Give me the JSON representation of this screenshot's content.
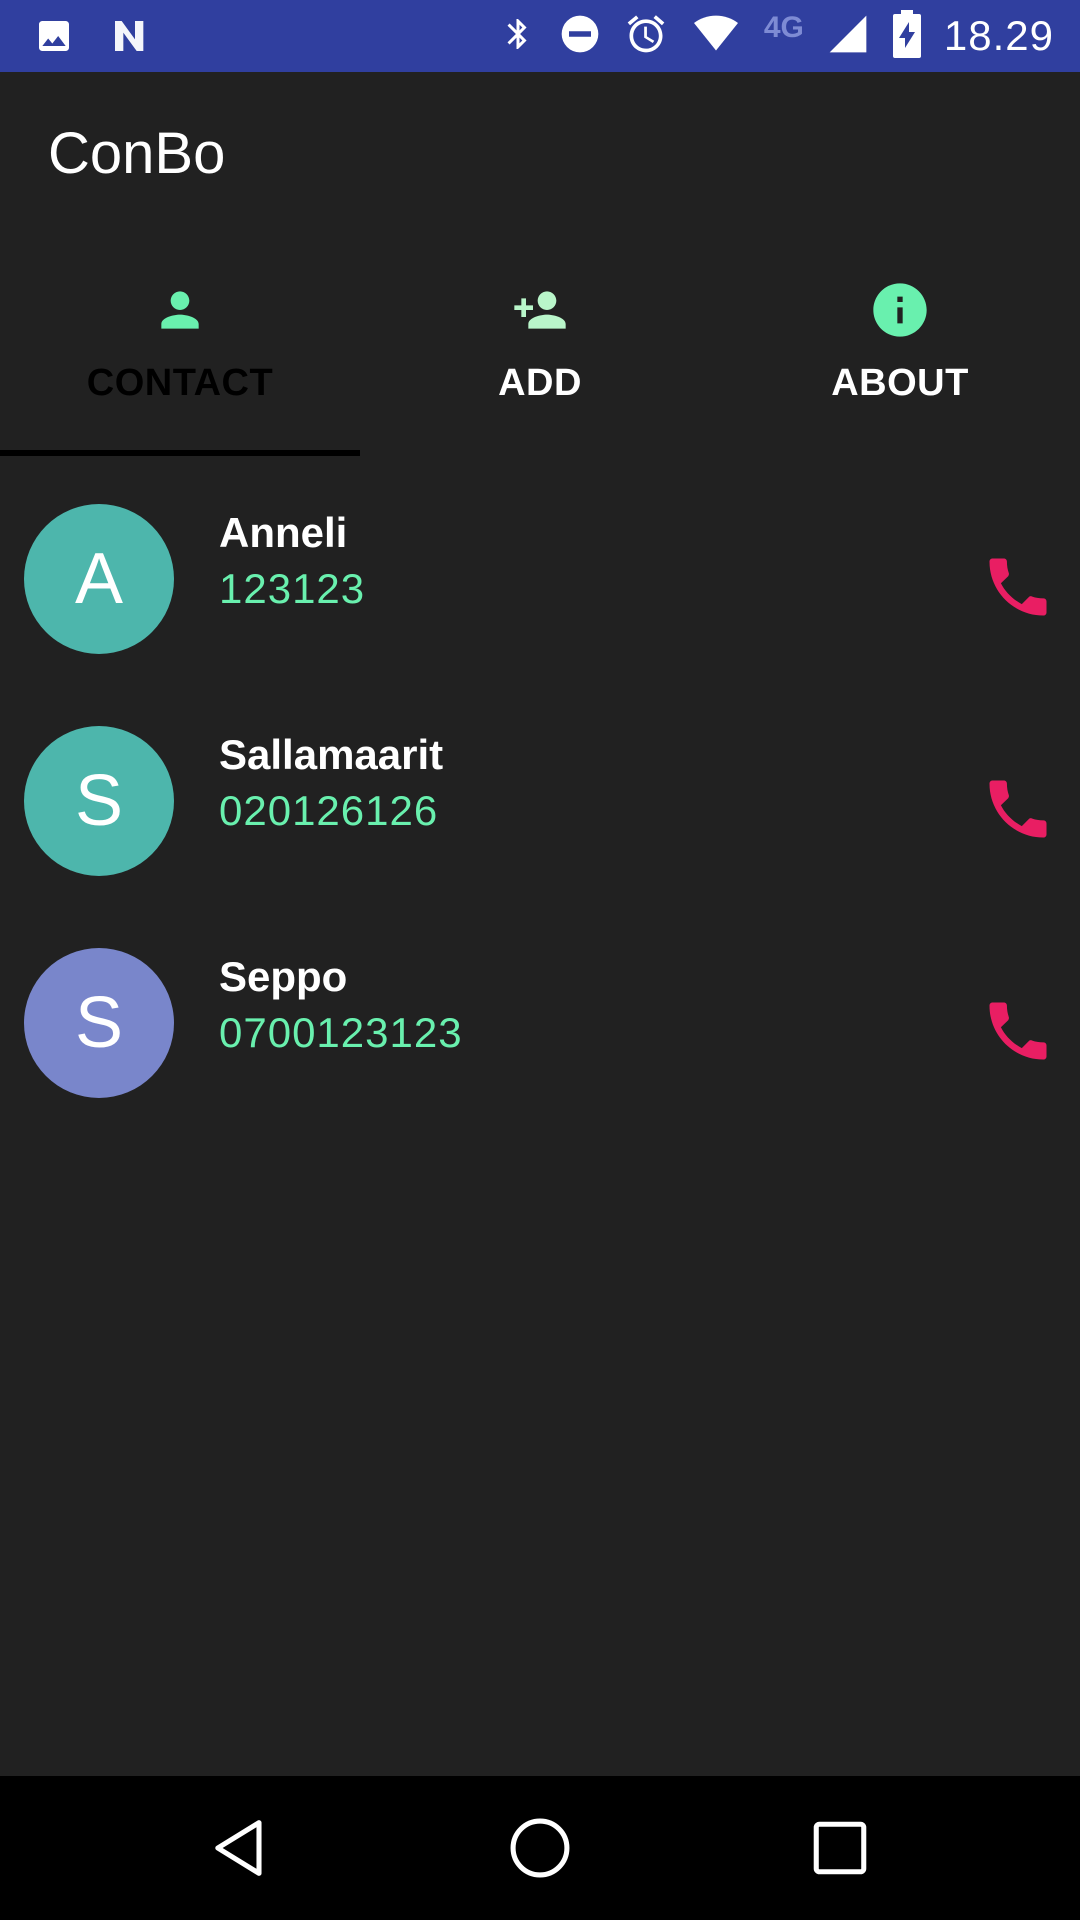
{
  "status_bar": {
    "time": "18.29",
    "network_label": "4G",
    "icons": [
      "image-icon",
      "n-icon",
      "bluetooth-icon",
      "do-not-disturb-icon",
      "alarm-icon",
      "wifi-icon",
      "signal-icon",
      "battery-charging-icon"
    ],
    "background": "#303f9f"
  },
  "app": {
    "title": "ConBo"
  },
  "tabs": [
    {
      "label": "CONTACT",
      "icon": "person-icon",
      "active": true
    },
    {
      "label": "ADD",
      "icon": "person-add-icon",
      "active": false
    },
    {
      "label": "ABOUT",
      "icon": "info-icon",
      "active": false
    }
  ],
  "contacts": [
    {
      "initial": "A",
      "name": "Anneli",
      "number": "123123",
      "avatar_color": "#4db6ac"
    },
    {
      "initial": "S",
      "name": "Sallamaarit",
      "number": "020126126",
      "avatar_color": "#4db6ac"
    },
    {
      "initial": "S",
      "name": "Seppo",
      "number": "0700123123",
      "avatar_color": "#7986cb"
    }
  ],
  "colors": {
    "accent": "#69f0ae",
    "call": "#e91e63",
    "background": "#212121"
  },
  "nav_bar": {
    "icons": [
      "back-icon",
      "home-icon",
      "recents-icon"
    ]
  }
}
